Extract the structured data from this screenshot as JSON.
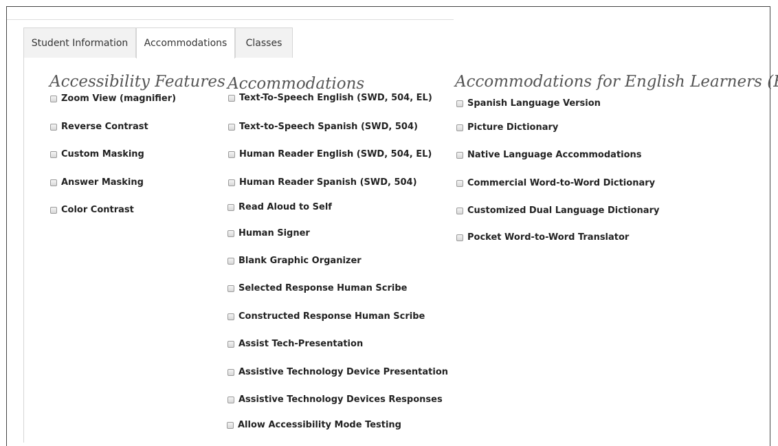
{
  "tabs": [
    {
      "label": "Student Information"
    },
    {
      "label": "Accommodations"
    },
    {
      "label": "Classes"
    }
  ],
  "accessibility_features": {
    "heading": "Accessibility Features",
    "items": [
      "Zoom View (magnifier)",
      "Reverse Contrast",
      "Custom Masking",
      "Answer Masking",
      "Color Contrast"
    ]
  },
  "accommodations": {
    "heading": "Accommodations",
    "items": [
      "Text-To-Speech English (SWD, 504, EL)",
      "Text-to-Speech Spanish (SWD, 504)",
      "Human Reader English (SWD, 504, EL)",
      "Human Reader Spanish (SWD, 504)",
      "Read Aloud to Self",
      "Human Signer",
      "Blank Graphic Organizer",
      "Selected Response Human Scribe",
      "Constructed Response Human Scribe",
      "Assist Tech-Presentation",
      "Assistive Technology Device Presentation",
      "Assistive Technology Devices Responses",
      "Allow Accessibility Mode Testing"
    ]
  },
  "el_accommodations": {
    "heading": "Accommodations for English Learners (EL)",
    "items": [
      "Spanish Language Version",
      "Picture Dictionary",
      "Native Language Accommodations",
      "Commercial Word-to-Word Dictionary",
      "Customized Dual Language Dictionary",
      "Pocket Word-to-Word Translator"
    ]
  }
}
